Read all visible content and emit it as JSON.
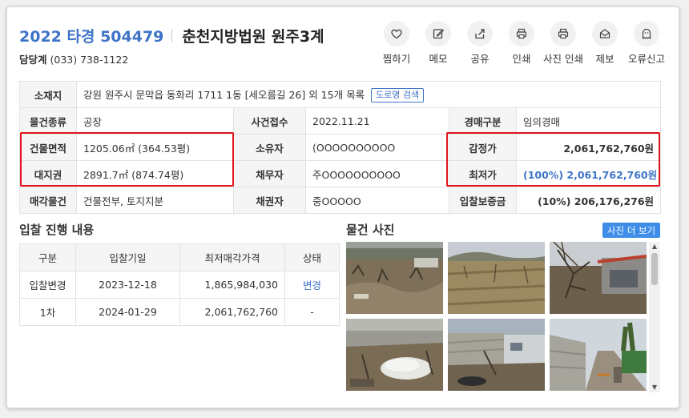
{
  "header": {
    "case_no": "2022 타경 504479",
    "court": "춘천지방법원 원주3계",
    "contact_label": "담당계",
    "contact_phone": "(033) 738-1122"
  },
  "actions": [
    {
      "label": "찜하기",
      "icon": "heart-icon"
    },
    {
      "label": "메모",
      "icon": "memo-icon"
    },
    {
      "label": "공유",
      "icon": "share-icon"
    },
    {
      "label": "인쇄",
      "icon": "print-icon"
    },
    {
      "label": "사진 인쇄",
      "icon": "photo-print-icon"
    },
    {
      "label": "제보",
      "icon": "mail-icon"
    },
    {
      "label": "오류신고",
      "icon": "ghost-icon"
    }
  ],
  "info": {
    "location_label": "소재지",
    "location_value": "강원 원주시 문막읍 동화리 1711 1동 [세오름길 26] 외 15개 목록",
    "road_search": "도로명 검색",
    "type_label": "물건종류",
    "type_value": "공장",
    "filed_label": "사건접수",
    "filed_value": "2022.11.21",
    "auction_type_label": "경매구분",
    "auction_type_value": "임의경매",
    "building_area_label": "건물면적",
    "building_area_value": "1205.06㎡ (364.53평)",
    "owner_label": "소유자",
    "owner_value": "(OOOOOOOOOO",
    "appraisal_label": "감정가",
    "appraisal_value": "2,061,762,760원",
    "land_right_label": "대지권",
    "land_right_value": "2891.7㎡ (874.74평)",
    "debtor_label": "채무자",
    "debtor_value": "주OOOOOOOOOO",
    "min_price_label": "최저가",
    "min_price_value": "(100%) 2,061,762,760원",
    "sale_item_label": "매각물건",
    "sale_item_value": "건물전부, 토지지분",
    "creditor_label": "채권자",
    "creditor_value": "중OOOOO",
    "deposit_label": "입찰보증금",
    "deposit_value": "(10%) 206,176,276원"
  },
  "bids": {
    "title": "입찰 진행 내용",
    "headers": [
      "구분",
      "입찰기일",
      "최저매각가격",
      "상태"
    ],
    "rows": [
      [
        "입찰변경",
        "2023-12-18",
        "1,865,984,030",
        "변경"
      ],
      [
        "1차",
        "2024-01-29",
        "2,061,762,760",
        "-"
      ]
    ]
  },
  "photos": {
    "title": "물건 사진",
    "more_button": "사진 더 보기"
  },
  "colors": {
    "accent": "#3e74c7",
    "highlight_border": "#e0161b",
    "button_blue": "#3e8de8"
  }
}
